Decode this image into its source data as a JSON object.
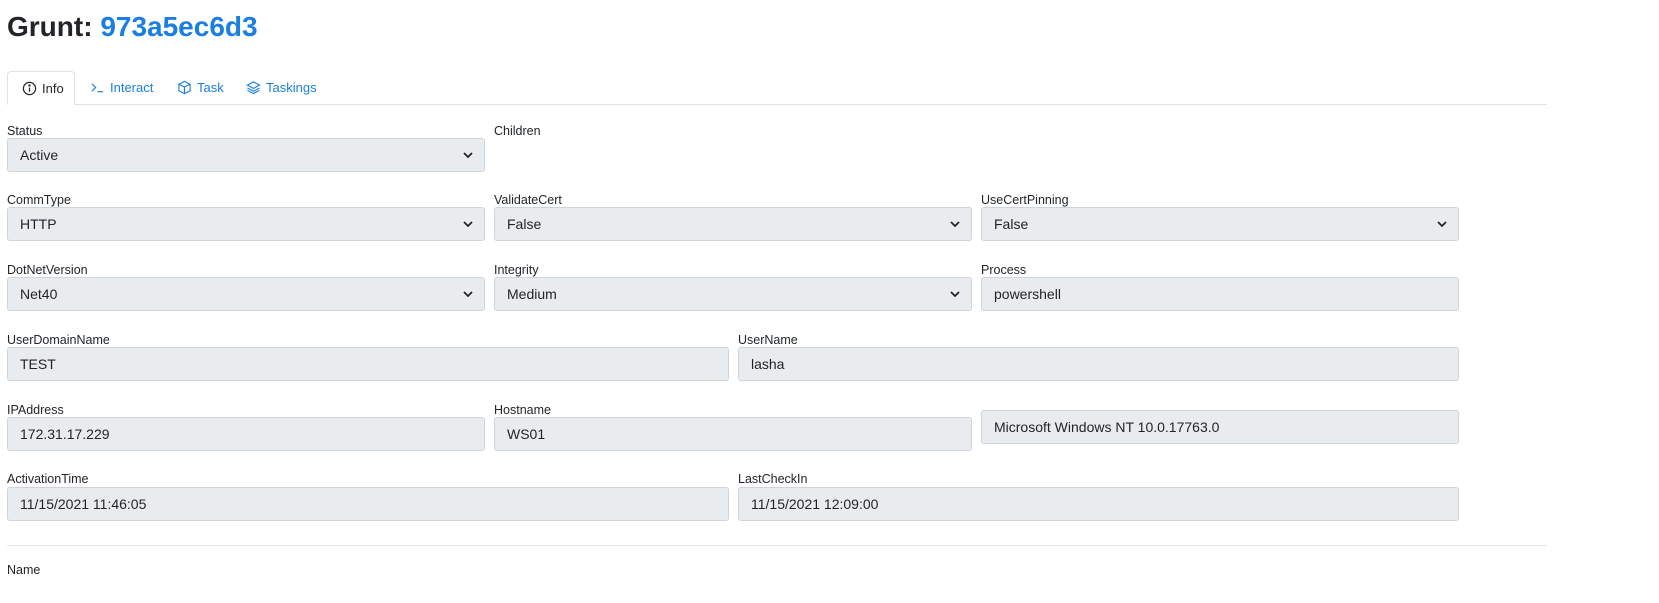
{
  "header": {
    "prefix": "Grunt:",
    "grunt_id": "973a5ec6d3"
  },
  "tabs": [
    {
      "label": "Info",
      "icon": "info-icon"
    },
    {
      "label": "Interact",
      "icon": "terminal-icon"
    },
    {
      "label": "Task",
      "icon": "box-icon"
    },
    {
      "label": "Taskings",
      "icon": "layers-icon"
    }
  ],
  "fields": {
    "status": {
      "label": "Status",
      "value": "Active"
    },
    "children": {
      "label": "Children"
    },
    "commtype": {
      "label": "CommType",
      "value": "HTTP"
    },
    "validatecert": {
      "label": "ValidateCert",
      "value": "False"
    },
    "usecertpinning": {
      "label": "UseCertPinning",
      "value": "False"
    },
    "dotnetversion": {
      "label": "DotNetVersion",
      "value": "Net40"
    },
    "integrity": {
      "label": "Integrity",
      "value": "Medium"
    },
    "process": {
      "label": "Process",
      "value": "powershell"
    },
    "userdomainname": {
      "label": "UserDomainName",
      "value": "TEST"
    },
    "username": {
      "label": "UserName",
      "value": "lasha"
    },
    "ipaddress": {
      "label": "IPAddress",
      "value": "172.31.17.229"
    },
    "hostname": {
      "label": "Hostname",
      "value": "WS01"
    },
    "os": {
      "value": "Microsoft Windows NT 10.0.17763.0"
    },
    "activationtime": {
      "label": "ActivationTime",
      "value": "11/15/2021 11:46:05"
    },
    "lastcheckin": {
      "label": "LastCheckIn",
      "value": "11/15/2021 12:09:00"
    },
    "name": {
      "label": "Name"
    }
  },
  "colors": {
    "link": "#1a7fe0",
    "field_bg": "#e9ecef",
    "border": "#ced4da"
  }
}
